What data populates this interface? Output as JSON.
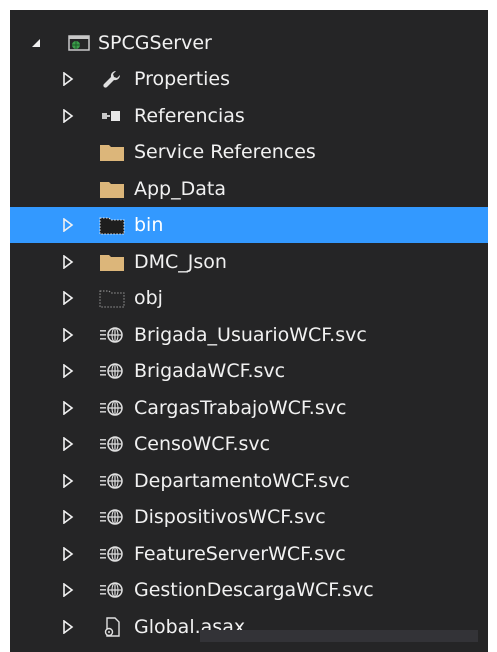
{
  "colors": {
    "panel_bg": "#252526",
    "selected_bg": "#3399ff",
    "text": "#f1f1f1",
    "folder": "#dcb67a"
  },
  "tree": {
    "root": {
      "label": "SPCGServer",
      "icon": "web-project-icon",
      "expanded": true
    },
    "items": [
      {
        "label": "Properties",
        "icon": "wrench-icon",
        "expander": true
      },
      {
        "label": "Referencias",
        "icon": "references-icon",
        "expander": true
      },
      {
        "label": "Service References",
        "icon": "folder-icon",
        "expander": false
      },
      {
        "label": "App_Data",
        "icon": "folder-icon",
        "expander": false
      },
      {
        "label": "bin",
        "icon": "hidden-folder-icon",
        "expander": true,
        "selected": true
      },
      {
        "label": "DMC_Json",
        "icon": "folder-icon",
        "expander": true
      },
      {
        "label": "obj",
        "icon": "dotted-folder-icon",
        "expander": true
      },
      {
        "label": "Brigada_UsuarioWCF.svc",
        "icon": "svc-file-icon",
        "expander": true
      },
      {
        "label": "BrigadaWCF.svc",
        "icon": "svc-file-icon",
        "expander": true
      },
      {
        "label": "CargasTrabajoWCF.svc",
        "icon": "svc-file-icon",
        "expander": true
      },
      {
        "label": "CensoWCF.svc",
        "icon": "svc-file-icon",
        "expander": true
      },
      {
        "label": "DepartamentoWCF.svc",
        "icon": "svc-file-icon",
        "expander": true
      },
      {
        "label": "DispositivosWCF.svc",
        "icon": "svc-file-icon",
        "expander": true
      },
      {
        "label": "FeatureServerWCF.svc",
        "icon": "svc-file-icon",
        "expander": true
      },
      {
        "label": "GestionDescargaWCF.svc",
        "icon": "svc-file-icon",
        "expander": true
      },
      {
        "label": "Global.asax",
        "icon": "asax-file-icon",
        "expander": true
      }
    ]
  }
}
